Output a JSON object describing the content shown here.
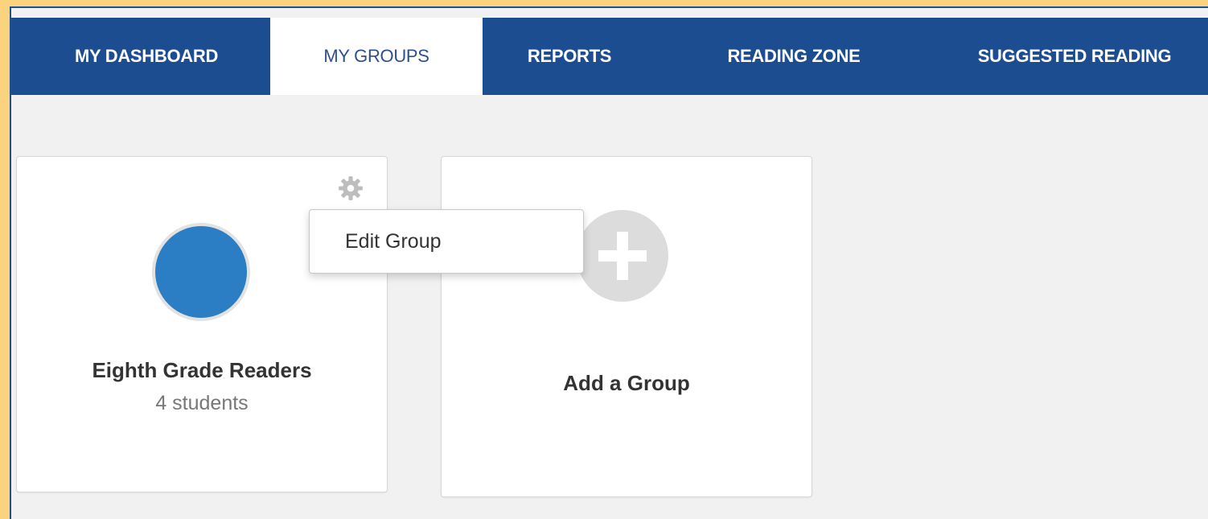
{
  "nav": {
    "tabs": [
      {
        "label": "MY DASHBOARD",
        "active": false
      },
      {
        "label": "MY GROUPS",
        "active": true
      },
      {
        "label": "REPORTS",
        "active": false
      },
      {
        "label": "READING ZONE",
        "active": false
      },
      {
        "label": "SUGGESTED READING",
        "active": false
      }
    ]
  },
  "groups": [
    {
      "name": "Eighth Grade Readers",
      "count": "4 students",
      "color": "#2b7ec4"
    }
  ],
  "add_group": {
    "label": "Add a Group"
  },
  "menu": {
    "items": [
      "Edit Group"
    ]
  },
  "colors": {
    "nav_bg": "#1c4d91",
    "frame": "#fbd27e",
    "active_tab_text": "#2f4f8f",
    "plus_circle": "#dcdcdc"
  },
  "icons": {
    "settings": "gear-icon",
    "add": "plus-icon"
  }
}
